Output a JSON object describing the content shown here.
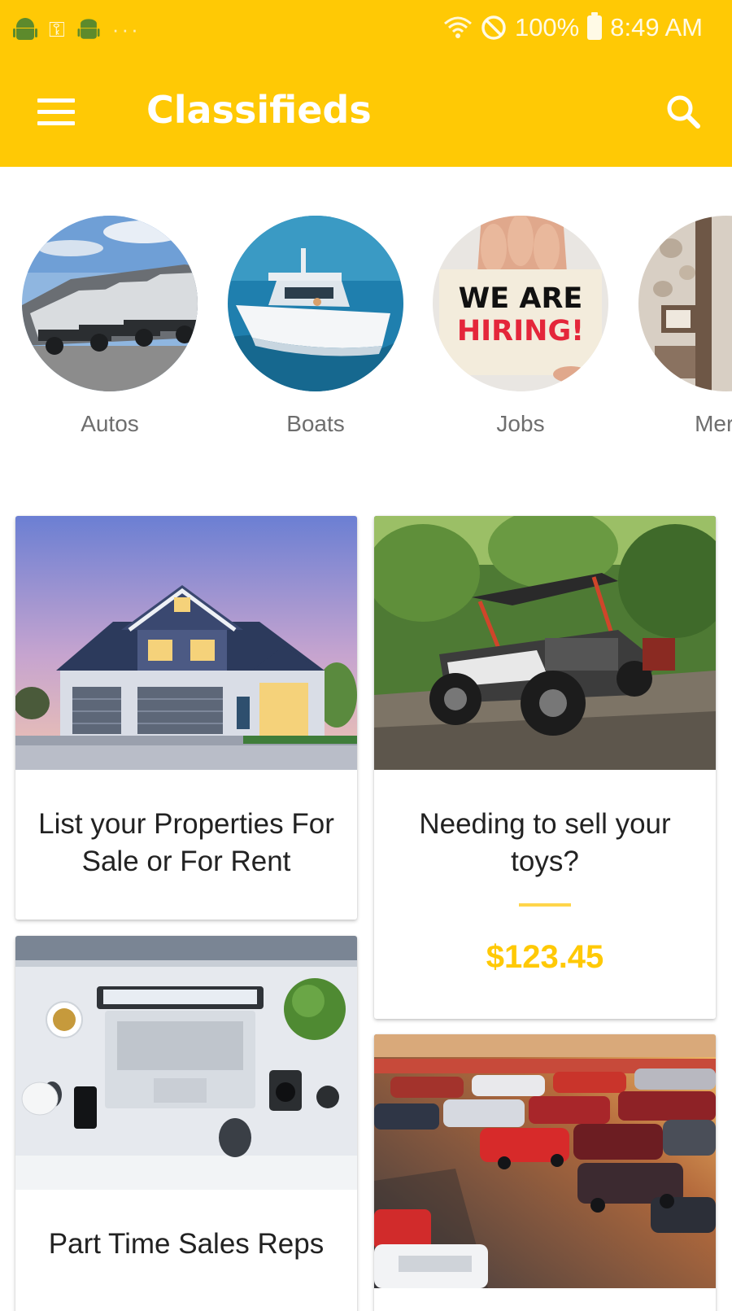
{
  "status_bar": {
    "battery": "100%",
    "time": "8:49 AM",
    "notification_icons": [
      "android-icon",
      "key-icon",
      "android-debug-icon",
      "more-icon"
    ],
    "system_icons": [
      "wifi-icon",
      "do-not-disturb-icon",
      "battery-icon"
    ]
  },
  "app_bar": {
    "title": "Classifieds",
    "color": "#FFC905",
    "menu_icon": "hamburger-menu-icon",
    "search_icon": "search-icon"
  },
  "categories": [
    {
      "label": "Autos",
      "image": "cars-in-lot"
    },
    {
      "label": "Boats",
      "image": "speedboat-on-water"
    },
    {
      "label": "Jobs",
      "image": "we-are-hiring-sign",
      "sign_line1": "WE ARE",
      "sign_line2": "HIRING!"
    },
    {
      "label": "Merch",
      "image": "interior-shelf"
    }
  ],
  "listings": [
    {
      "caption": "List your Properties For Sale or For Rent",
      "image": "house-at-dusk"
    },
    {
      "caption": "Needing to sell your toys?",
      "price": "$123.45",
      "image": "offroad-buggy"
    },
    {
      "caption": "Part Time Sales Reps",
      "image": "desk-with-laptop"
    },
    {
      "caption": "",
      "image": "car-dealership-lot"
    }
  ],
  "colors": {
    "accent": "#FFC905",
    "price": "#FFC905",
    "category_label": "#6e6e6e",
    "caption_text": "#222222"
  }
}
